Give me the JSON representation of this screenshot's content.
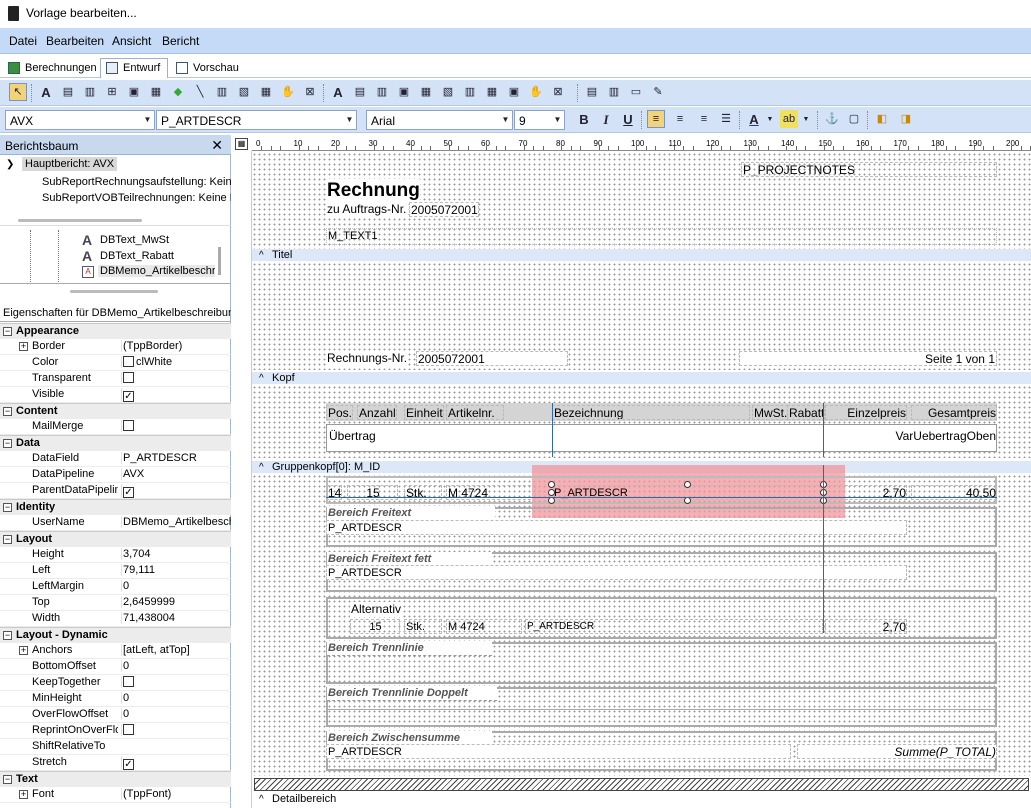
{
  "window": {
    "title": "Vorlage bearbeiten..."
  },
  "menu": [
    "Datei",
    "Bearbeiten",
    "Ansicht",
    "Bericht"
  ],
  "tabs": [
    "Berechnungen",
    "Entwurf",
    "Vorschau"
  ],
  "toolbar": {
    "font_combo": "AVX",
    "field_combo": "P_ARTDESCR",
    "font_name": "Arial",
    "font_size": "9",
    "bold": "B",
    "italic": "I",
    "underline": "U"
  },
  "tree": {
    "title": "Berichtsbaum",
    "items": [
      "Hauptbericht: AVX",
      "SubReportRechnungsaufstellung: Keine",
      "SubReportVOBTeilrechnungen: Keine D"
    ],
    "components": [
      "DBText_MwSt",
      "DBText_Rabatt",
      "DBMemo_Artikelbeschre"
    ]
  },
  "props": {
    "title": "Eigenschaften für DBMemo_Artikelbeschreibung",
    "groups": [
      {
        "name": "Appearance",
        "rows": [
          {
            "n": "Border",
            "v": "(TppBorder)",
            "expand": true
          },
          {
            "n": "Color",
            "v": "clWhite",
            "swatch": true
          },
          {
            "n": "Transparent",
            "check": false
          },
          {
            "n": "Visible",
            "check": true
          }
        ]
      },
      {
        "name": "Content",
        "rows": [
          {
            "n": "MailMerge",
            "check": false
          }
        ]
      },
      {
        "name": "Data",
        "rows": [
          {
            "n": "DataField",
            "v": "P_ARTDESCR"
          },
          {
            "n": "DataPipeline",
            "v": "AVX"
          },
          {
            "n": "ParentDataPipeline",
            "check": true
          }
        ]
      },
      {
        "name": "Identity",
        "rows": [
          {
            "n": "UserName",
            "v": "DBMemo_Artikelbeschr"
          }
        ]
      },
      {
        "name": "Layout",
        "rows": [
          {
            "n": "Height",
            "v": "3,704"
          },
          {
            "n": "Left",
            "v": "79,111"
          },
          {
            "n": "LeftMargin",
            "v": "0"
          },
          {
            "n": "Top",
            "v": "2,6459999"
          },
          {
            "n": "Width",
            "v": "71,438004"
          }
        ]
      },
      {
        "name": "Layout - Dynamic",
        "rows": [
          {
            "n": "Anchors",
            "v": "[atLeft, atTop]",
            "expand": true
          },
          {
            "n": "BottomOffset",
            "v": "0"
          },
          {
            "n": "KeepTogether",
            "check": false
          },
          {
            "n": "MinHeight",
            "v": "0"
          },
          {
            "n": "OverFlowOffset",
            "v": "0"
          },
          {
            "n": "ReprintOnOverFlo",
            "check": false
          },
          {
            "n": "ShiftRelativeTo",
            "v": ""
          },
          {
            "n": "Stretch",
            "check": true
          }
        ]
      },
      {
        "name": "Text",
        "rows": [
          {
            "n": "Font",
            "v": "(TppFont)",
            "expand": true
          }
        ]
      }
    ]
  },
  "ruler": [
    "0",
    "10",
    "20",
    "30",
    "40",
    "50",
    "60",
    "70",
    "80",
    "90",
    "100",
    "110",
    "120",
    "130",
    "140",
    "150",
    "160",
    "170",
    "180",
    "190",
    "200"
  ],
  "report": {
    "p_projectnotes": "P_PROJECTNOTES",
    "rechnung": "Rechnung",
    "zu_auftrags_label": "zu Auftrags-Nr.",
    "zu_auftrags_value": "2005072001",
    "m_text1": "M_TEXT1",
    "band_titel": "Titel",
    "rechnungs_nr_label": "Rechnungs-Nr.",
    "rechnungs_nr_value": "2005072001",
    "seite": "Seite 1 von 1",
    "band_kopf": "Kopf",
    "headers": [
      "Pos.",
      "Anzahl",
      "Einheit",
      "Artikelnr.",
      "Bezeichnung",
      "MwSt.",
      "Rabatt",
      "Einzelpreis",
      "Gesamtpreis"
    ],
    "uebertrag": "Übertrag",
    "var_uebertrag": "VarUebertragOben",
    "band_gruppe": "Gruppenkopf[0]: M_ID",
    "row": {
      "pos": "14",
      "anzahl": "15",
      "einheit": "Stk.",
      "artnr": "M 4724",
      "descr": "P_ARTDESCR",
      "einzel": "2,70",
      "gesamt": "40,50"
    },
    "freitext": "Bereich Freitext",
    "freitext_fld": "P_ARTDESCR",
    "freitext_fett": "Bereich Freitext fett",
    "freitext_fett_fld": "P_ARTDESCR",
    "alternativ": "Alternativ",
    "alt_row": {
      "anzahl": "15",
      "einheit": "Stk.",
      "artnr": "M 4724",
      "descr": "P_ARTDESCR",
      "einzel": "2,70"
    },
    "trennlinie": "Bereich Trennlinie",
    "trennlinie_doppelt": "Bereich Trennlinie Doppelt",
    "zwischensumme": "Bereich Zwischensumme",
    "zwischen_fld": "P_ARTDESCR",
    "summe": "Summe(P_TOTAL)",
    "band_detail": "Detailbereich"
  }
}
